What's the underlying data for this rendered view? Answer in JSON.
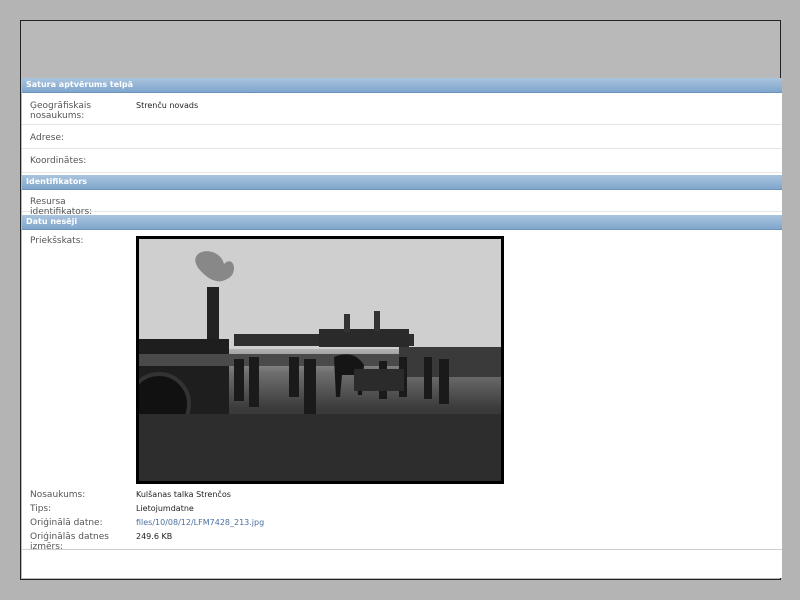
{
  "sections": {
    "spatial": {
      "title": "Satura aptvērums telpā",
      "geo_label": "Ģeogrāfiskais nosaukums:",
      "geo_value": "Strenču novads",
      "address_label": "Adrese:",
      "coords_label": "Koordinātes:"
    },
    "identifiers": {
      "title": "Identifikators",
      "resource_id_label": "Resursa identifikators:"
    },
    "media": {
      "title": "Datu nesēji",
      "preview_label": "Priekšskats:",
      "name_label": "Nosaukums:",
      "name_value": "Kulšanas talka Strenčos",
      "type_label": "Tips:",
      "type_value": "Lietojumdatne",
      "orig_file_label": "Oriģinālā datne:",
      "orig_file_value": "files/10/08/12/LFM7428_213.jpg",
      "orig_size_label": "Oriģinālās datnes izmērs:",
      "orig_size_value": "249.6 KB"
    }
  },
  "colors": {
    "header_gradient_top": "#a9c4de",
    "header_gradient_bottom": "#7fa6cc",
    "link": "#4b6fa0",
    "background": "#b4b4b4"
  }
}
